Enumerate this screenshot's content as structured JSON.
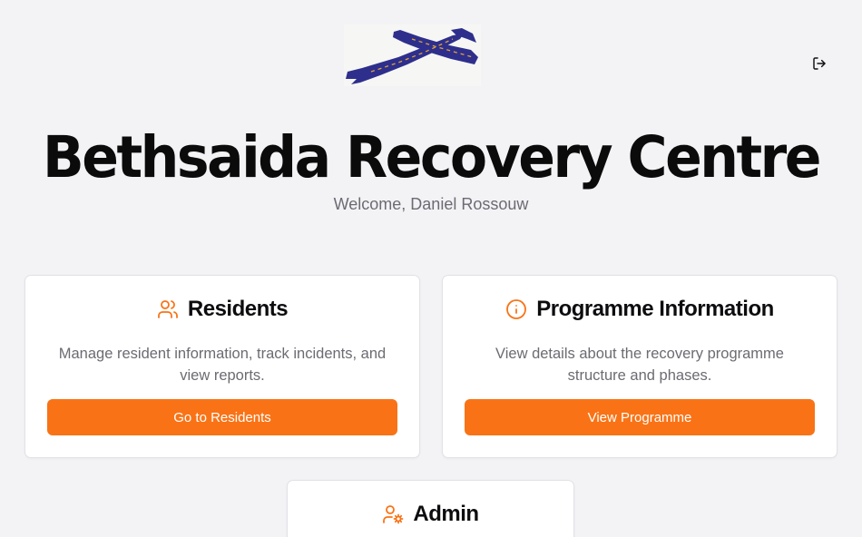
{
  "header": {
    "title": "Bethsaida Recovery Centre",
    "welcome": "Welcome, Daniel Rossouw"
  },
  "cards": [
    {
      "title": "Residents",
      "icon": "users-icon",
      "description": "Manage resident information, track incidents, and view reports.",
      "button_label": "Go to Residents"
    },
    {
      "title": "Programme Information",
      "icon": "info-icon",
      "description": "View details about the recovery programme structure and phases.",
      "button_label": "View Programme"
    },
    {
      "title": "Admin",
      "icon": "user-cog-icon"
    }
  ],
  "colors": {
    "accent": "#f97316",
    "background": "#f3f3f6",
    "muted_text": "#6b6b72"
  }
}
